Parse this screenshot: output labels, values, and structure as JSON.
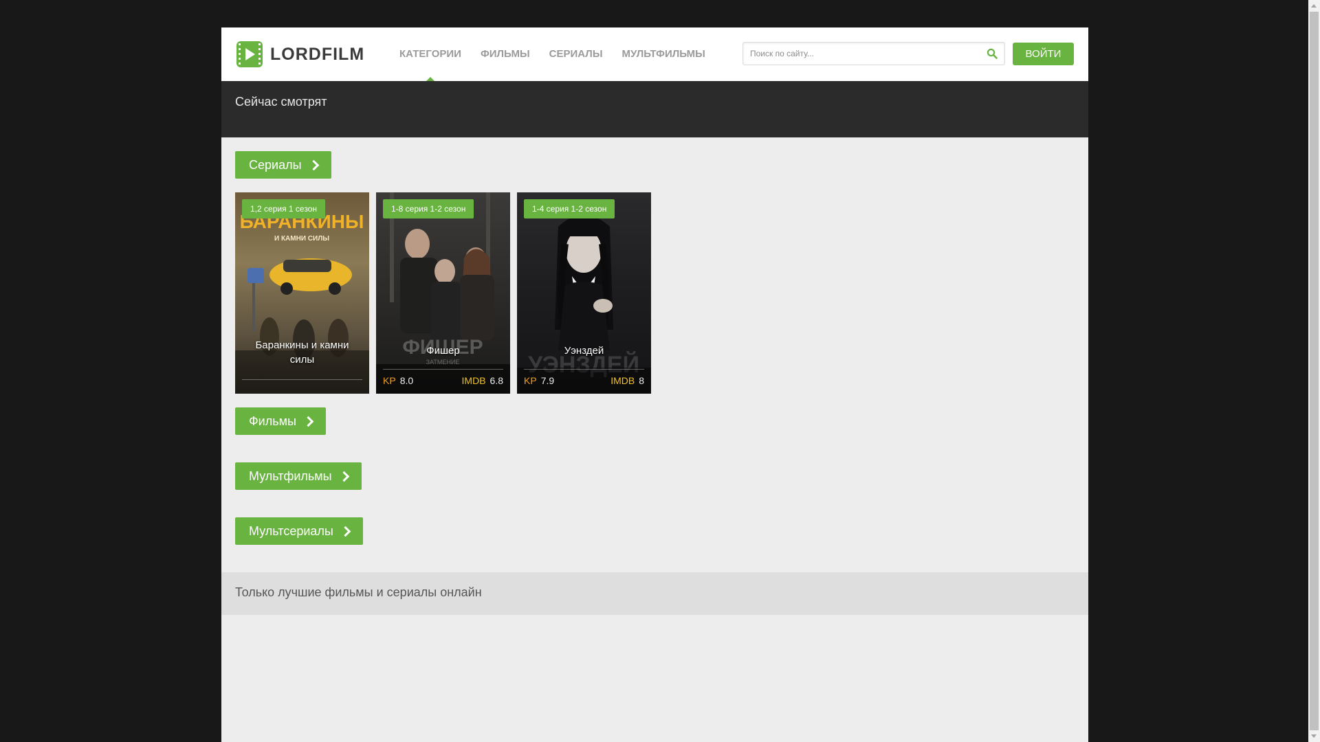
{
  "site": {
    "logo_text": "LORDFILM"
  },
  "nav": [
    {
      "label": "КАТЕГОРИИ",
      "active": true
    },
    {
      "label": "ФИЛЬМЫ"
    },
    {
      "label": "СЕРИАЛЫ"
    },
    {
      "label": "МУЛЬТФИЛЬМЫ"
    }
  ],
  "search": {
    "placeholder": "Поиск по сайту...",
    "value": ""
  },
  "auth": {
    "login_label": "ВОЙТИ"
  },
  "now_watching": {
    "title": "Сейчас смотрят"
  },
  "categories": [
    {
      "label": "Сериалы"
    },
    {
      "label": "Фильмы"
    },
    {
      "label": "Мультфильмы"
    },
    {
      "label": "Мультсериалы"
    }
  ],
  "cards": [
    {
      "badge": "1,2 серия 1 сезон",
      "title": "Баранкины и камни силы",
      "kp_label": "",
      "kp": "",
      "imdb_label": "",
      "imdb": ""
    },
    {
      "badge": "1-8 серия 1-2 сезон",
      "title": "Фишер",
      "kp_label": "KP",
      "kp": "8.0",
      "imdb_label": "IMDB",
      "imdb": "6.8"
    },
    {
      "badge": "1-4 серия 1-2 сезон",
      "title": "Уэнздей",
      "kp_label": "KP",
      "kp": "7.9",
      "imdb_label": "IMDB",
      "imdb": "8"
    }
  ],
  "footer": {
    "tagline": "Только лучшие фильмы и сериалы онлайн"
  },
  "colors": {
    "accent": "#69b341",
    "header_bg": "#ffffff",
    "dark_band": "#2b2b2b",
    "page_bg": "#ededed",
    "outer_bg": "#181818"
  }
}
